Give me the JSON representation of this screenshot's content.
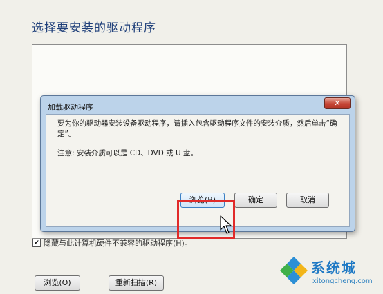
{
  "window": {
    "title": "选择要安装的驱动程序",
    "hide_incompatible_label": "隐藏与此计算机硬件不兼容的驱动程序(H)。",
    "hide_incompatible_checked": true,
    "browse_label": "浏览(O)",
    "rescan_label": "重新扫描(R)"
  },
  "dialog": {
    "title": "加载驱动程序",
    "close_icon": "close-icon",
    "close_glyph": "✕",
    "message": "要为你的驱动器安装设备驱动程序，请插入包含驱动程序文件的安装介质，然后单击“确定”。",
    "note": "注意: 安装介质可以是 CD、DVD 或 U 盘。",
    "browse_label": "浏览(B)",
    "ok_label": "确定",
    "cancel_label": "取消"
  },
  "annotation": {
    "highlight_color": "#e12a2a"
  },
  "watermark": {
    "name": "系统城",
    "url": "xitongcheng.com"
  }
}
